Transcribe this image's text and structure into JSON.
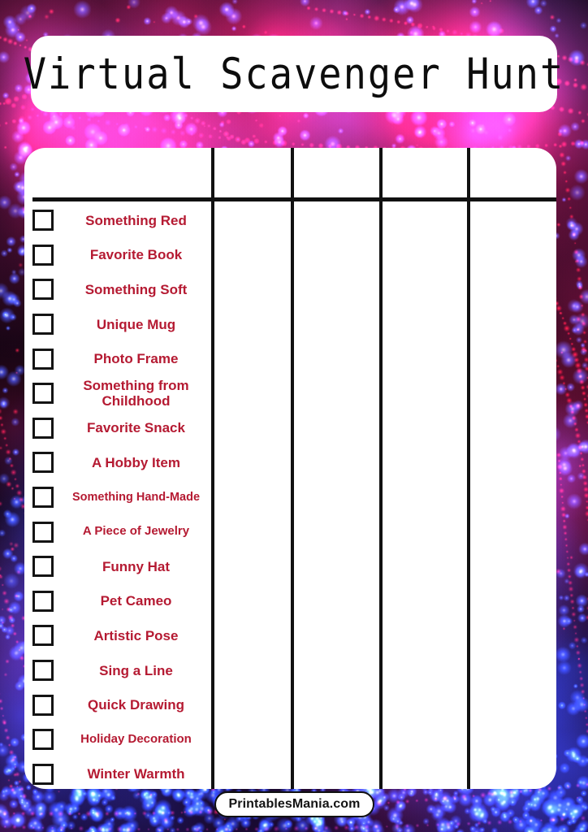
{
  "page": {
    "title": "Virtual Scavenger Hunt",
    "accent_red": "#b51a32",
    "ink": "#141414",
    "card_bg": "#ffffff",
    "background_style": "neon-bokeh-red-blue"
  },
  "title_bar": {
    "label": "Virtual Scavenger Hunt"
  },
  "table": {
    "header_row": {
      "cells": [
        "",
        "",
        "",
        "",
        ""
      ]
    },
    "column_dividers_x": [
      230,
      328,
      437,
      545
    ],
    "player_columns": 4
  },
  "checklist": {
    "items": [
      {
        "label": "Something Red",
        "size": "md",
        "lines": 1
      },
      {
        "label": "Favorite Book",
        "size": "md",
        "lines": 1
      },
      {
        "label": "Something Soft",
        "size": "md",
        "lines": 1
      },
      {
        "label": "Unique Mug",
        "size": "md",
        "lines": 1
      },
      {
        "label": "Photo Frame",
        "size": "md",
        "lines": 1
      },
      {
        "label": "Something from Childhood",
        "size": "md",
        "lines": 2
      },
      {
        "label": "Favorite Snack",
        "size": "md",
        "lines": 1
      },
      {
        "label": "A Hobby Item",
        "size": "md",
        "lines": 1
      },
      {
        "label": "Something Hand-Made",
        "size": "xs",
        "lines": 1
      },
      {
        "label": "A Piece of Jewelry",
        "size": "sm",
        "lines": 1
      },
      {
        "label": "Funny Hat",
        "size": "md",
        "lines": 1
      },
      {
        "label": "Pet Cameo",
        "size": "md",
        "lines": 1
      },
      {
        "label": "Artistic Pose",
        "size": "md",
        "lines": 1
      },
      {
        "label": "Sing a Line",
        "size": "md",
        "lines": 1
      },
      {
        "label": "Quick Drawing",
        "size": "md",
        "lines": 1
      },
      {
        "label": "Holiday Decoration",
        "size": "sm",
        "lines": 1
      },
      {
        "label": "Winter Warmth",
        "size": "md",
        "lines": 1
      }
    ]
  },
  "footer": {
    "label": "PrintablesMania.com"
  }
}
